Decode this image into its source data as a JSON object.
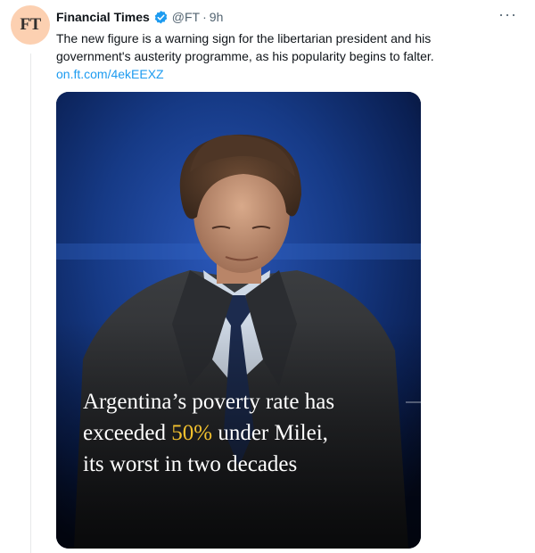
{
  "author": {
    "name": "Financial Times",
    "handle": "@FT",
    "separator": "·",
    "time": "9h",
    "avatar_text": "FT",
    "avatar_color": "#fcd0b1",
    "verified_icon": "verified-badge-icon"
  },
  "menu": {
    "more_label": "···"
  },
  "tweet": {
    "text_line1": "The new figure is a warning sign for the libertarian president and his",
    "text_line2": "government's austerity programme, as his popularity begins to falter.",
    "link": "on.ft.com/4ekEEXZ"
  },
  "media": {
    "headline_line1": "Argentina’s poverty rate has",
    "headline_line2_pre": "exceeded ",
    "headline_line2_accent": "50%",
    "headline_line2_post": " under Milei,",
    "headline_line3": "its worst in two decades",
    "accent_color": "#f2c12e",
    "background_color": "#0b1a3a"
  },
  "colors": {
    "link": "#1d9bf0",
    "secondary_text": "#536471",
    "verified_badge": "#1d9bf0"
  }
}
